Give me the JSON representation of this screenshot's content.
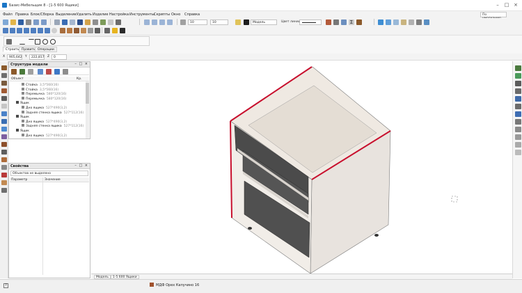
{
  "window": {
    "title": "Базис-Мебельщик 8 - [1-5 600 Ящики]",
    "minimize": "–",
    "maximize": "□",
    "close": "×"
  },
  "menu": {
    "items": [
      "Файл",
      "Правка",
      "Блок/Сборка",
      "Выделение",
      "Удалить",
      "Изделие",
      "Настройка",
      "Инструменты",
      "Скрипты",
      "Окно",
      "Справка"
    ],
    "user_select": "По умолчанию"
  },
  "toolbar": {
    "layer_combo": "10",
    "layer2_combo": "10",
    "material_combo": "Модель",
    "color_label": "Цвет линии:"
  },
  "tabs": [
    "Строить",
    "Править",
    "Операции"
  ],
  "coords": {
    "x_label": "X",
    "x_value": "905,642",
    "y_label": "Y",
    "y_value": "222,817",
    "z_label": "Z",
    "z_value": "0"
  },
  "model_panel": {
    "title": "Структура модели",
    "col_object": "Объект",
    "col_extra": "Кр.",
    "rows": [
      {
        "name": "Стойка",
        "sub": "3,5*560(16)"
      },
      {
        "name": "Стойка",
        "sub": "3,5*560(16)"
      },
      {
        "name": "Перемычка",
        "sub": "580*120(16)"
      },
      {
        "name": "Перемычка",
        "sub": "580*120(16)"
      },
      {
        "name": "Ящик",
        "sub": ""
      },
      {
        "name": "Дно ящика",
        "sub": "527*490(3,2)"
      },
      {
        "name": "Задняя стенка ящика",
        "sub": "527*112(16)"
      },
      {
        "name": "Ящик",
        "sub": ""
      },
      {
        "name": "Дно ящика",
        "sub": "527*490(3,2)"
      },
      {
        "name": "Задняя стенка ящика",
        "sub": "527*112(16)"
      },
      {
        "name": "Ящик",
        "sub": ""
      },
      {
        "name": "Дно ящика",
        "sub": "527*490(3,2)"
      }
    ]
  },
  "props_panel": {
    "title": "Свойства",
    "selector": "Объектов не выделено",
    "col_param": "Параметр",
    "col_value": "Значение"
  },
  "view_tabs": [
    "Модель",
    "1-5 600 Ящики"
  ],
  "status": {
    "material": "МДФ Орех Капучино 16"
  },
  "colors": {
    "edge_red": "#c8102e",
    "panel_light": "#ece7e1",
    "panel_dark": "#4a4a4a",
    "accent_blue": "#1b76c7"
  }
}
